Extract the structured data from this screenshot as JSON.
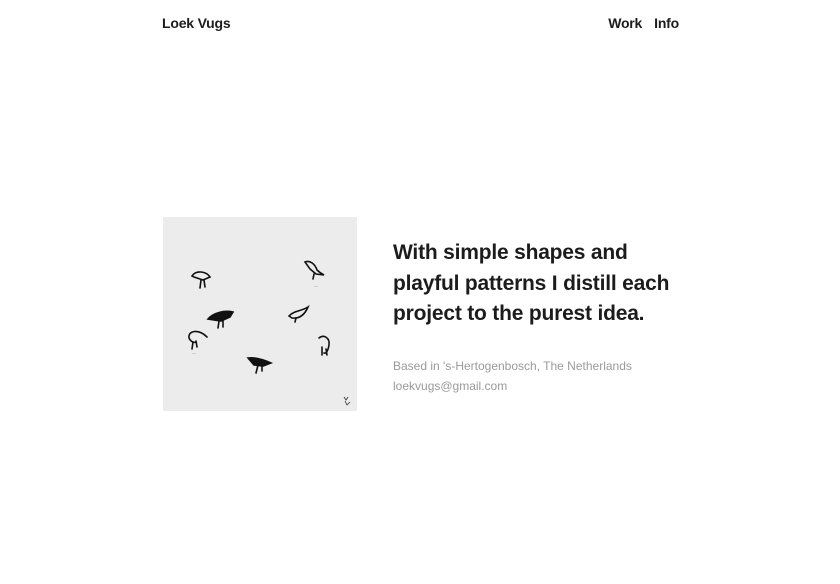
{
  "header": {
    "logo": "Loek Vugs",
    "nav": [
      {
        "label": "Work"
      },
      {
        "label": "Info"
      }
    ]
  },
  "hero": {
    "image_alt": "Birds illustration",
    "headline": "With simple shapes and playful patterns I distill each project to the purest idea.",
    "location": "Based in 's-Hertogenbosch, The Netherlands",
    "email": "loekvugs@gmail.com"
  },
  "colors": {
    "text": "#1c1c1c",
    "muted": "#9a9a9a",
    "image_bg": "#ececec"
  }
}
